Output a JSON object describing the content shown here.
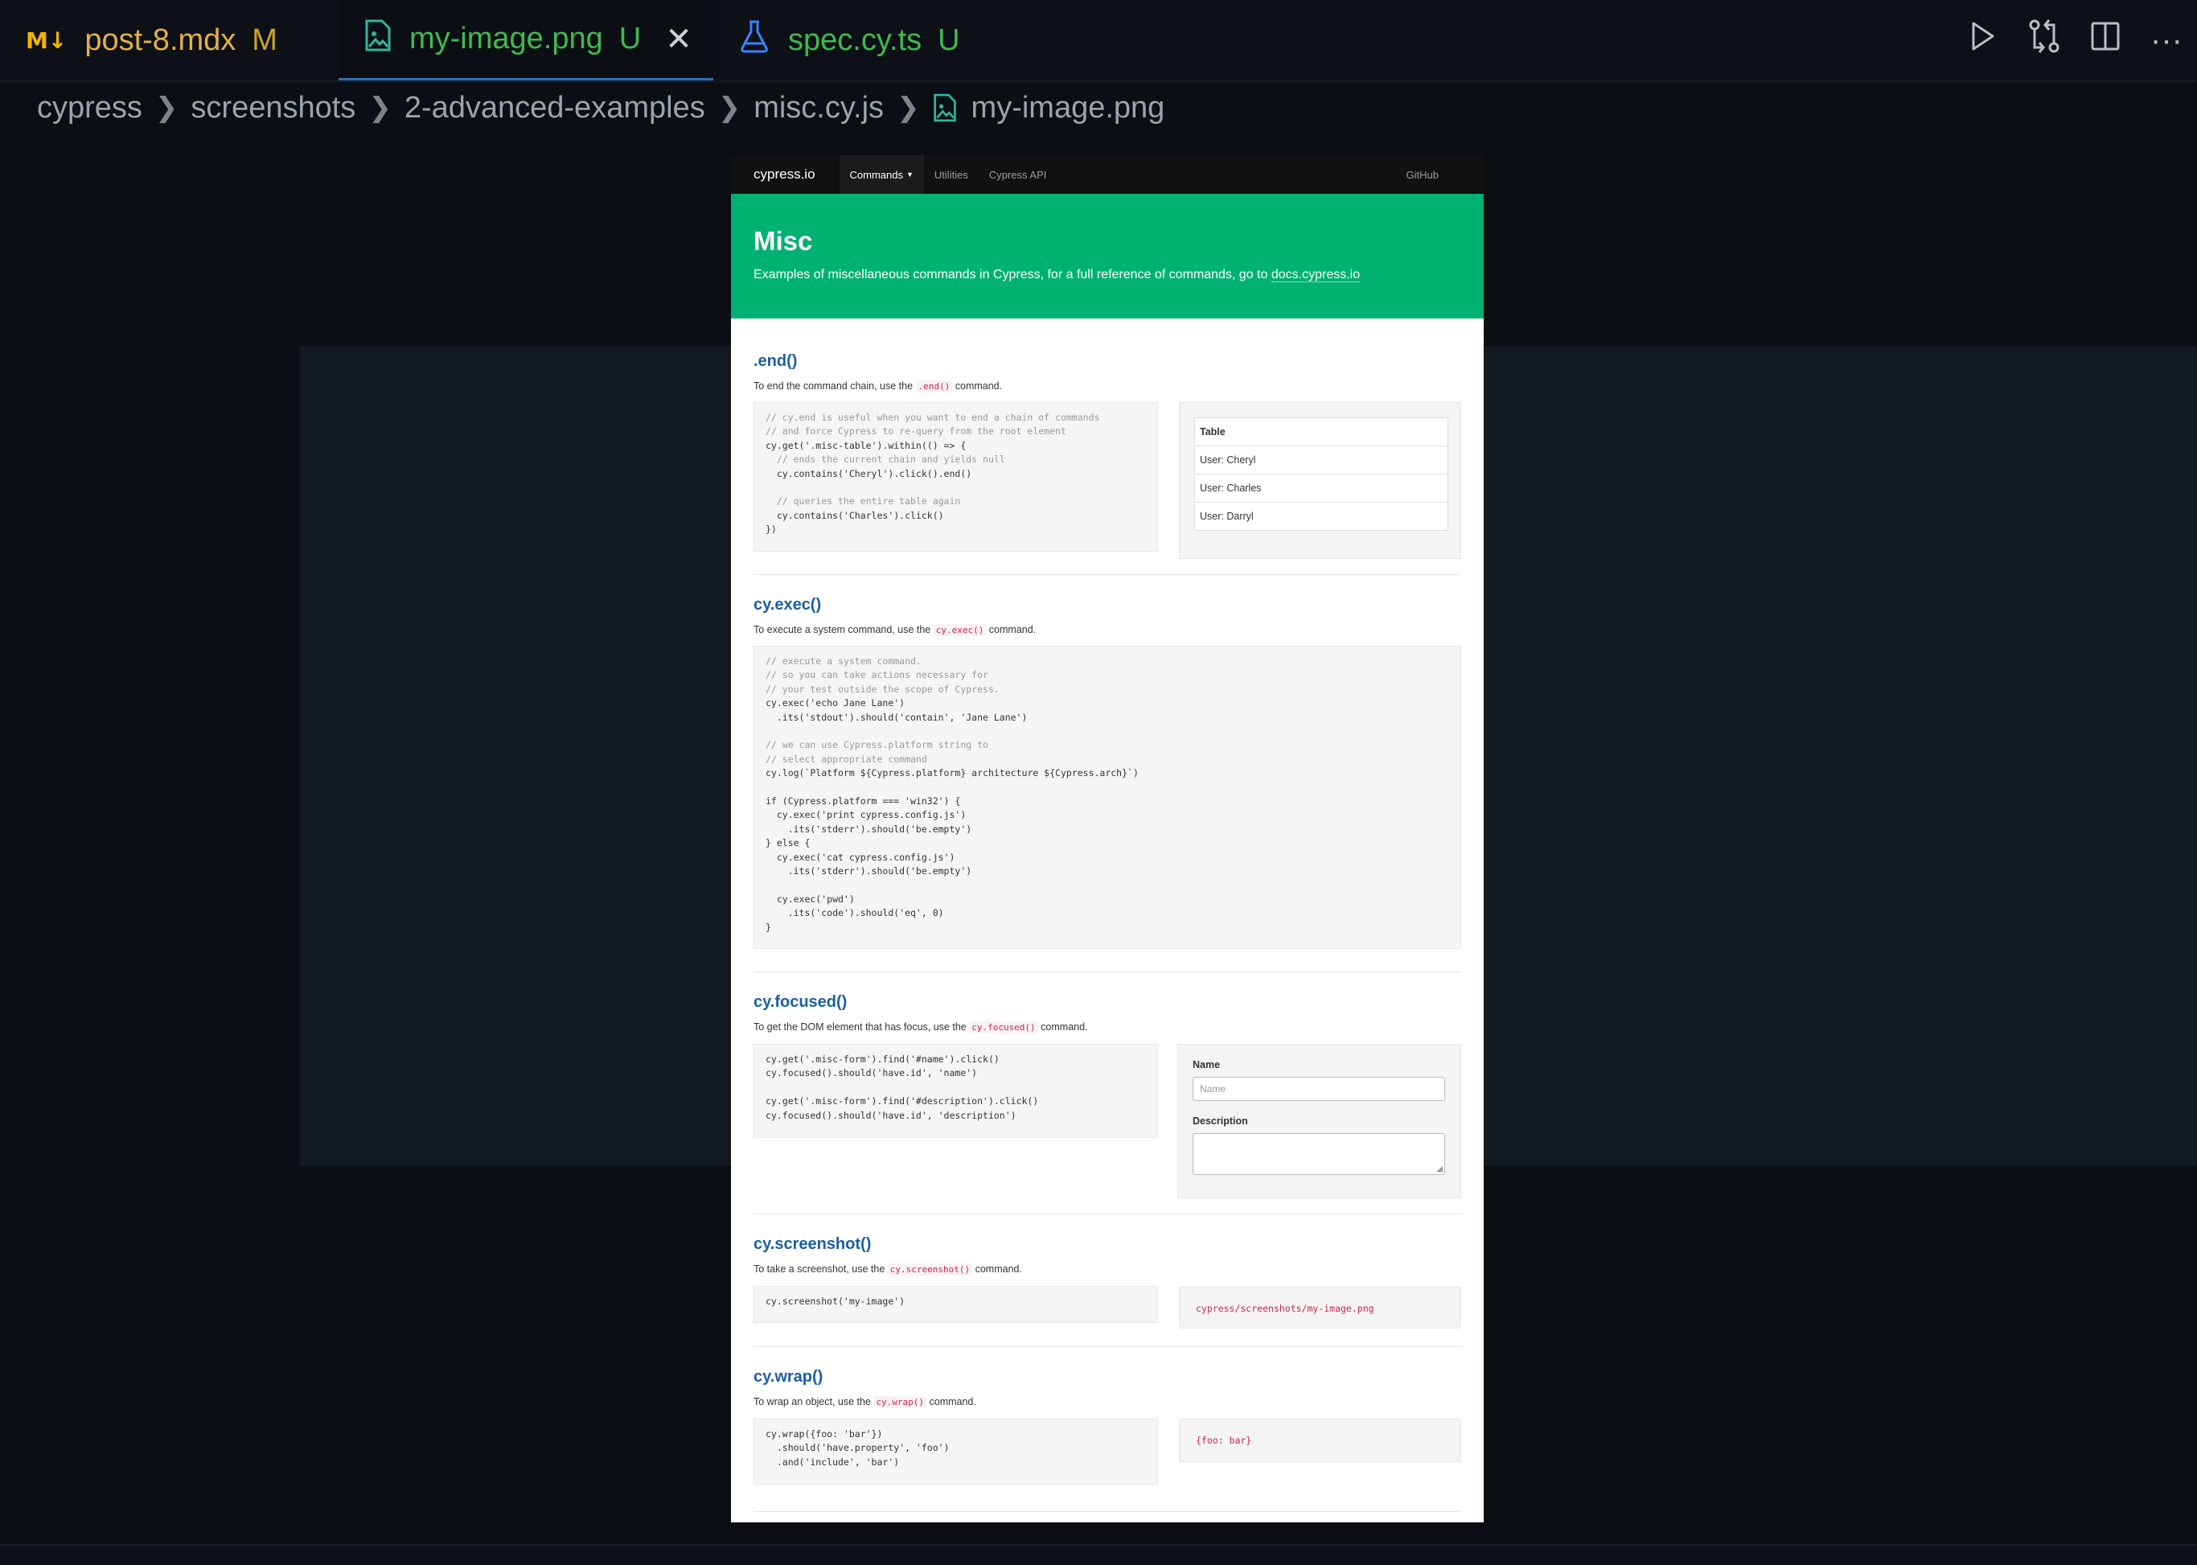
{
  "tabs": [
    {
      "icon": "markdown-icon",
      "name": "post-8.mdx",
      "status": "M",
      "status_color": "#c9a42a",
      "name_color": "#e2b049"
    },
    {
      "icon": "image-file-icon",
      "name": "my-image.png",
      "status": "U",
      "status_color": "#3fb950",
      "name_color": "#3fb950",
      "active": true
    },
    {
      "icon": "flask-icon",
      "name": "spec.cy.ts",
      "status": "U",
      "status_color": "#3fb950",
      "name_color": "#3fb950"
    }
  ],
  "toolbar_icons": [
    "run-icon",
    "compare-changes-icon",
    "split-editor-icon",
    "more-actions-icon"
  ],
  "breadcrumb": [
    "cypress",
    "screenshots",
    "2-advanced-examples",
    "misc.cy.js",
    "my-image.png"
  ],
  "preview": {
    "nav": {
      "brand": "cypress.io",
      "links": [
        "Commands",
        "Utilities",
        "Cypress API"
      ],
      "right_link": "GitHub"
    },
    "hero": {
      "title": "Misc",
      "subtitle_prefix": "Examples of miscellaneous commands in Cypress, for a full reference of commands, go to ",
      "subtitle_link": "docs.cypress.io"
    },
    "sections": {
      "end": {
        "title": ".end()",
        "desc_prefix": "To end the command chain, use the ",
        "desc_code": ".end()",
        "desc_suffix": " command.",
        "table_header": "Table",
        "table_rows": [
          "User: Cheryl",
          "User: Charles",
          "User: Darryl"
        ]
      },
      "exec": {
        "title": "cy.exec()",
        "desc_prefix": "To execute a system command, use the ",
        "desc_code": "cy.exec()",
        "desc_suffix": " command."
      },
      "focused": {
        "title": "cy.focused()",
        "desc_prefix": "To get the DOM element that has focus, use the ",
        "desc_code": "cy.focused()",
        "desc_suffix": " command.",
        "name_label": "Name",
        "name_placeholder": "Name",
        "description_label": "Description"
      },
      "screenshot": {
        "title": "cy.screenshot()",
        "desc_prefix": "To take a screenshot, use the ",
        "desc_code": "cy.screenshot()",
        "desc_suffix": " command.",
        "output": "cypress/screenshots/my-image.png"
      },
      "wrap": {
        "title": "cy.wrap()",
        "desc_prefix": "To wrap an object, use the ",
        "desc_code": "cy.wrap()",
        "desc_suffix": " command.",
        "output": "{foo: bar}"
      }
    },
    "code": {
      "end": [
        "// cy.end is useful when you want to end a chain of commands",
        "// and force Cypress to re-query from the root element",
        "cy.get('.misc-table').within(() => {",
        "  // ends the current chain and yields null",
        "  cy.contains('Cheryl').click().end()",
        "",
        "  // queries the entire table again",
        "  cy.contains('Charles').click()",
        "})"
      ],
      "exec": [
        "// execute a system command.",
        "// so you can take actions necessary for",
        "// your test outside the scope of Cypress.",
        "cy.exec('echo Jane Lane')",
        "  .its('stdout').should('contain', 'Jane Lane')",
        "",
        "// we can use Cypress.platform string to",
        "// select appropriate command",
        "cy.log(`Platform ${Cypress.platform} architecture ${Cypress.arch}`)",
        "",
        "if (Cypress.platform === 'win32') {",
        "  cy.exec('print cypress.config.js')",
        "    .its('stderr').should('be.empty')",
        "} else {",
        "  cy.exec('cat cypress.config.js')",
        "    .its('stderr').should('be.empty')",
        "",
        "  cy.exec('pwd')",
        "    .its('code').should('eq', 0)",
        "}"
      ],
      "focused": [
        "cy.get('.misc-form').find('#name').click()",
        "cy.focused().should('have.id', 'name')",
        "",
        "cy.get('.misc-form').find('#description').click()",
        "cy.focused().should('have.id', 'description')"
      ],
      "screenshot": [
        "cy.screenshot('my-image')"
      ],
      "wrap": [
        "cy.wrap({foo: 'bar'})",
        "  .should('have.property', 'foo')",
        "  .and('include', 'bar')"
      ]
    }
  }
}
